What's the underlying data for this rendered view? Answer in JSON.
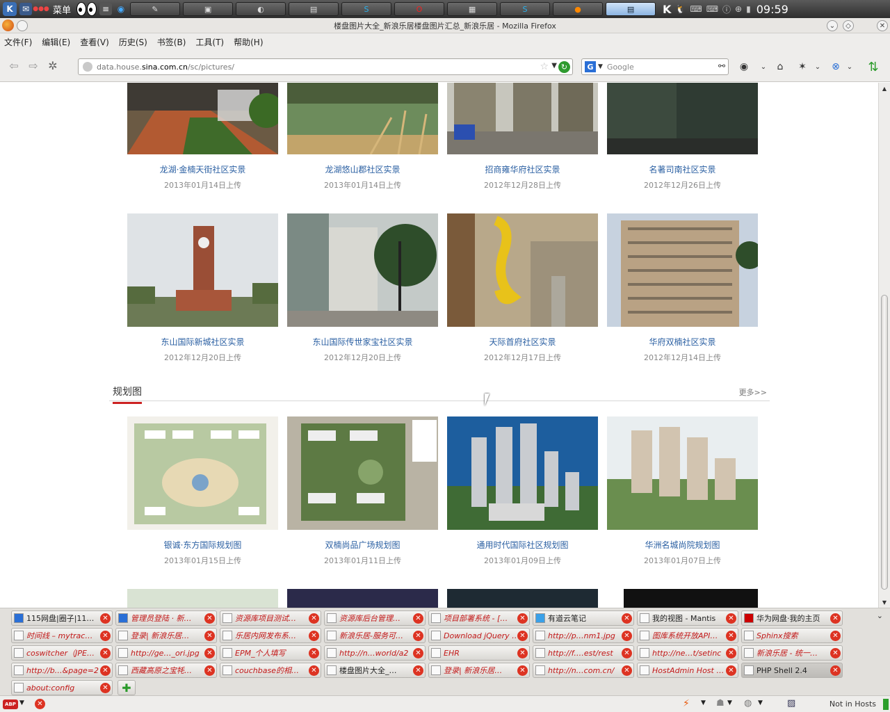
{
  "os_panel": {
    "k_label": "K",
    "menu_label": "菜单",
    "clock": "09:59",
    "task_items": [
      "",
      "",
      "",
      "",
      "S",
      "O",
      "",
      "S",
      "",
      ""
    ]
  },
  "window": {
    "title": "楼盘图片大全_新浪乐居楼盘图片汇总_新浪乐居 - Mozilla Firefox"
  },
  "menubar": [
    "文件(F)",
    "编辑(E)",
    "查看(V)",
    "历史(S)",
    "书签(B)",
    "工具(T)",
    "帮助(H)"
  ],
  "navbar": {
    "url_prefix": "data.house.",
    "url_domain": "sina.com.cn",
    "url_suffix": "/sc/pictures/",
    "search_engine": "G",
    "search_placeholder": "Google"
  },
  "gallery_rows": [
    {
      "cards": [
        {
          "name": "龙湖·金楠天街社区实景",
          "date": "2013年01月14日上传"
        },
        {
          "name": "龙湖悠山郡社区实景",
          "date": "2013年01月14日上传"
        },
        {
          "name": "招商雍华府社区实景",
          "date": "2012年12月28日上传"
        },
        {
          "name": "名著司南社区实景",
          "date": "2012年12月26日上传"
        }
      ]
    },
    {
      "cards": [
        {
          "name": "东山国际新城社区实景",
          "date": "2012年12月20日上传"
        },
        {
          "name": "东山国际传世家宝社区实景",
          "date": "2012年12月20日上传"
        },
        {
          "name": "天际首府社区实景",
          "date": "2012年12月17日上传"
        },
        {
          "name": "华府双楠社区实景",
          "date": "2012年12月14日上传"
        }
      ]
    }
  ],
  "planning": {
    "title": "规划图",
    "more": "更多>>",
    "cards": [
      {
        "name": "银诚·东方国际规划图",
        "date": "2013年01月15日上传"
      },
      {
        "name": "双楠尚品广场规划图",
        "date": "2013年01月11日上传"
      },
      {
        "name": "通用时代国际社区规划图",
        "date": "2013年01月09日上传"
      },
      {
        "name": "华洲名城尚院规划图",
        "date": "2013年01月07日上传"
      }
    ]
  },
  "tabs": [
    [
      "115网盘|圈子|11…",
      "管理员登陆 · 新…",
      "资源库项目测试…",
      "资源库后台管理…",
      "项目部署系统 - […",
      "有道云笔记",
      "我的视图 - Mantis",
      "华为网盘·我的主页"
    ],
    [
      "时间线 – mytrac…",
      "登录| 新浪乐居…",
      "乐居内网发布系…",
      "新浪乐居-服务可…",
      "Download jQuery …",
      "http://p…nm1.jpg",
      "图库系统开放API…",
      "Sphinx搜索"
    ],
    [
      "coswitcher（JPE…",
      "http://ge…_ori.jpg",
      "EPM_个人填写",
      "http://n…world/a2",
      "EHR",
      "http://f.…est/rest",
      "http://ne…t/setinc",
      "新浪乐居 - 统一…"
    ],
    [
      "http://b…&page=2",
      "西藏高原之宝牦…",
      "couchbase的相…",
      "楼盘图片大全_…",
      "登录| 新浪乐居…",
      "http://n…com.cn/",
      "HostAdmin Host …",
      "PHP Shell 2.4"
    ],
    [
      "about:config"
    ]
  ],
  "status": {
    "abp": "ABP",
    "hosts": "Not in Hosts"
  }
}
